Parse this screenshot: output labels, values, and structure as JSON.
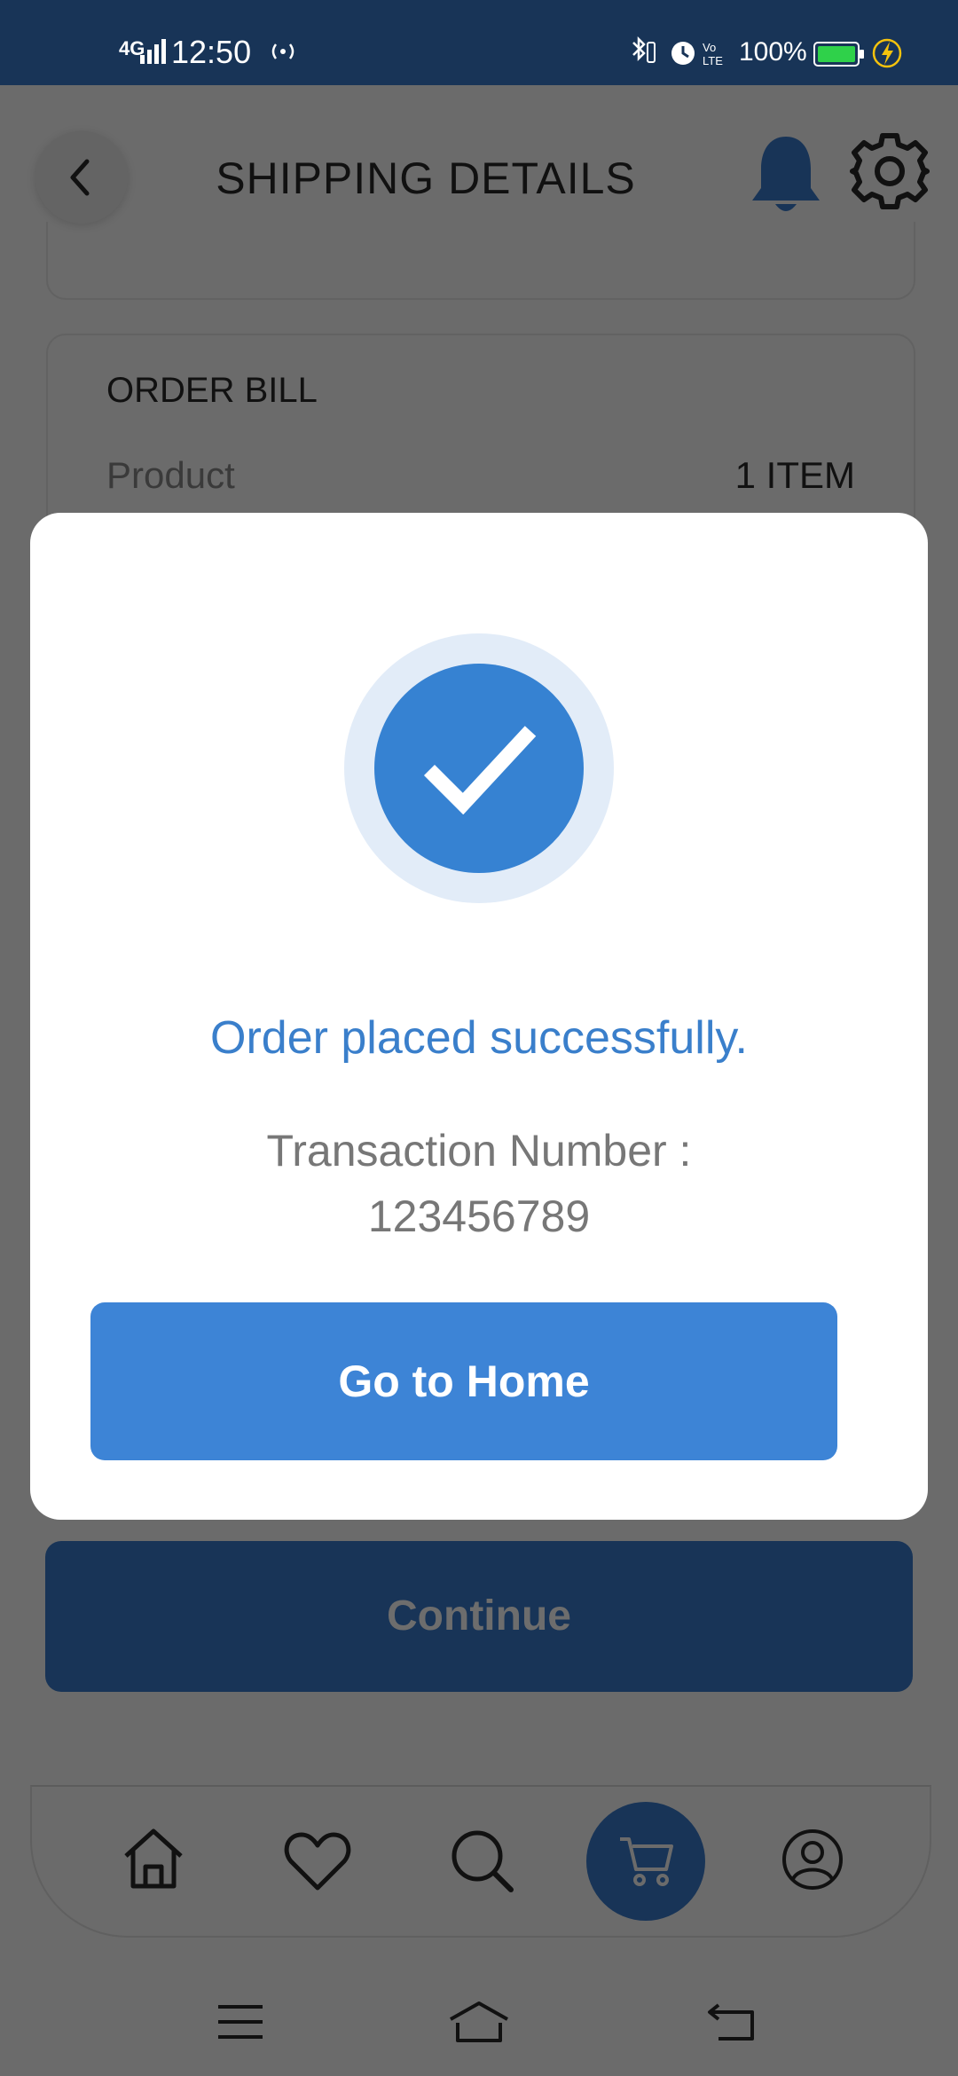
{
  "status_bar": {
    "network": "4G",
    "time": "12:50",
    "battery_percent": "100%"
  },
  "header": {
    "title": "SHIPPING DETAILS"
  },
  "order_bill": {
    "title": "ORDER BILL",
    "rows": [
      {
        "label": "Product",
        "value": "1 ITEM"
      }
    ]
  },
  "continue_button": {
    "label": "Continue"
  },
  "modal": {
    "message": "Order placed successfully.",
    "transaction_label": "Transaction Number :",
    "transaction_number": "123456789",
    "button_label": "Go to Home",
    "accent_color": "#3682d2"
  },
  "bottom_nav": {
    "items": [
      "home-icon",
      "heart-icon",
      "search-icon",
      "cart-icon",
      "profile-icon"
    ],
    "active": "cart-icon"
  },
  "colors": {
    "primary_dark": "#183457",
    "primary": "#3d84d6",
    "overlay": "#6b6b6b"
  }
}
